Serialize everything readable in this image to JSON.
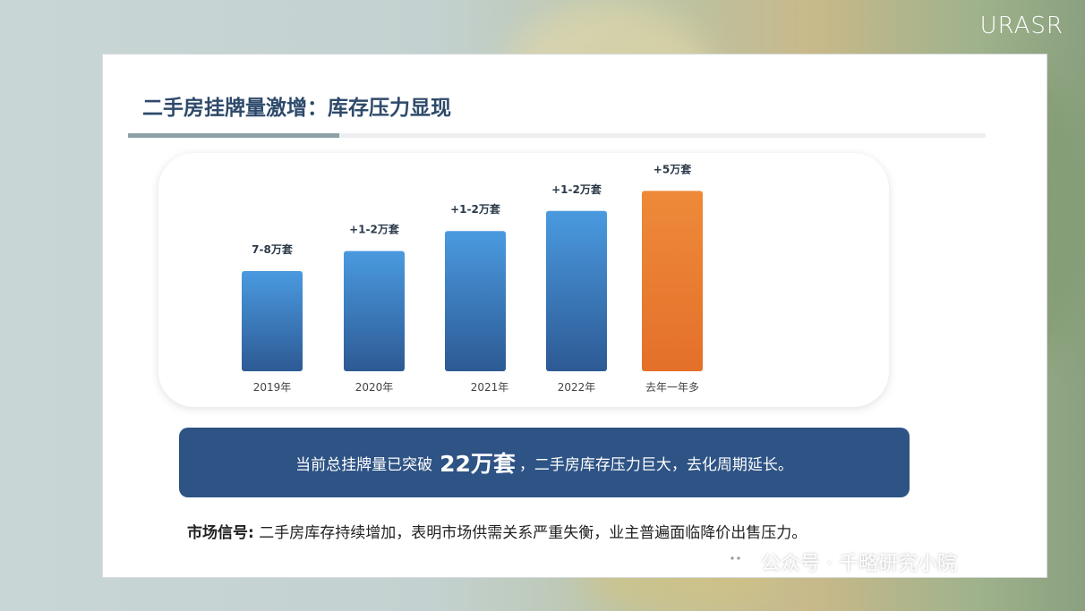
{
  "brand": {
    "logo_text": "URASR"
  },
  "slide": {
    "title": "二手房挂牌量激增：库存压力显现",
    "banner": {
      "prefix": "当前总挂牌量已突破",
      "highlight": "22万套",
      "suffix": "，二手房库存压力巨大，去化周期延长。"
    },
    "signal": {
      "label": "市场信号:",
      "text": " 二手房库存持续增加，表明市场供需关系严重失衡，业主普遍面临降价出售压力。"
    }
  },
  "watermark": {
    "text": "公众号 · 千略研究小院"
  },
  "colors": {
    "bar_blue_top": "#4a9ae0",
    "bar_blue_bottom": "#2d5a94",
    "bar_orange_top": "#ee8a3a",
    "bar_orange_bottom": "#e4702a",
    "title": "#2e4a6b",
    "banner": "#2e5385"
  },
  "chart_data": {
    "type": "bar",
    "categories": [
      "2019年",
      "2020年",
      "2021年",
      "2022年",
      "去年一年多"
    ],
    "values": [
      7.5,
      1.5,
      1.5,
      1.5,
      5
    ],
    "cumulative_relative_height": [
      1.0,
      1.2,
      1.4,
      1.6,
      1.8
    ],
    "data_labels": [
      "7-8万套",
      "+1-2万套",
      "+1-2万套",
      "+1-2万套",
      "+5万套"
    ],
    "highlight_index": 4,
    "unit": "万套",
    "grid": false,
    "legend": "none"
  }
}
